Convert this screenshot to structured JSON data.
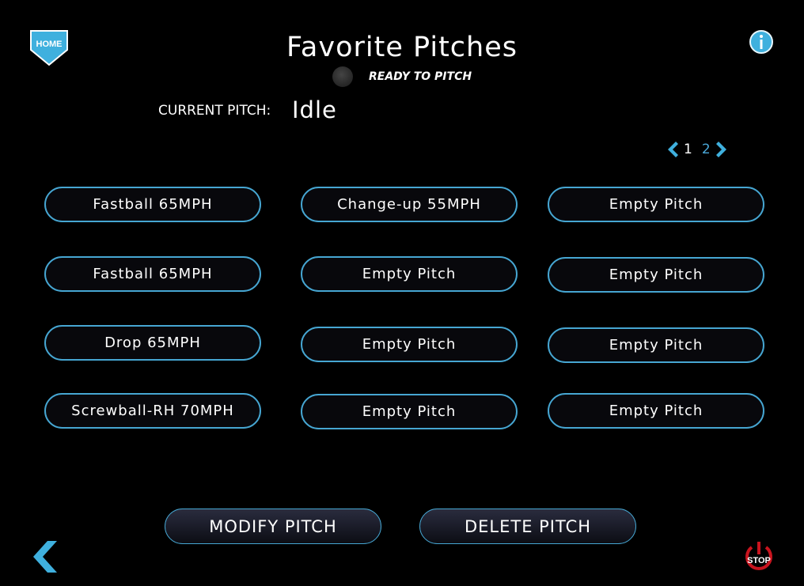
{
  "header": {
    "title": "Favorite Pitches",
    "home_label": "HOME",
    "status_text": "READY TO PITCH",
    "info_icon": "info-icon"
  },
  "current_pitch": {
    "label": "CURRENT PITCH:",
    "value": "Idle"
  },
  "pager": {
    "pages": [
      "1",
      "2"
    ],
    "current": "1"
  },
  "pitches": [
    {
      "label": "Fastball 65MPH"
    },
    {
      "label": "Change-up 55MPH"
    },
    {
      "label": "Empty Pitch"
    },
    {
      "label": "Fastball 65MPH"
    },
    {
      "label": "Empty Pitch"
    },
    {
      "label": "Empty Pitch"
    },
    {
      "label": "Drop 65MPH"
    },
    {
      "label": "Empty Pitch"
    },
    {
      "label": "Empty Pitch"
    },
    {
      "label": "Screwball-RH 70MPH"
    },
    {
      "label": "Empty Pitch"
    },
    {
      "label": "Empty Pitch"
    }
  ],
  "actions": {
    "modify_label": "MODIFY PITCH",
    "delete_label": "DELETE PITCH"
  },
  "footer": {
    "stop_label": "STOP"
  },
  "colors": {
    "accent": "#46a6d2",
    "home_fill": "#3fb0de",
    "stop_red": "#c8141e"
  }
}
